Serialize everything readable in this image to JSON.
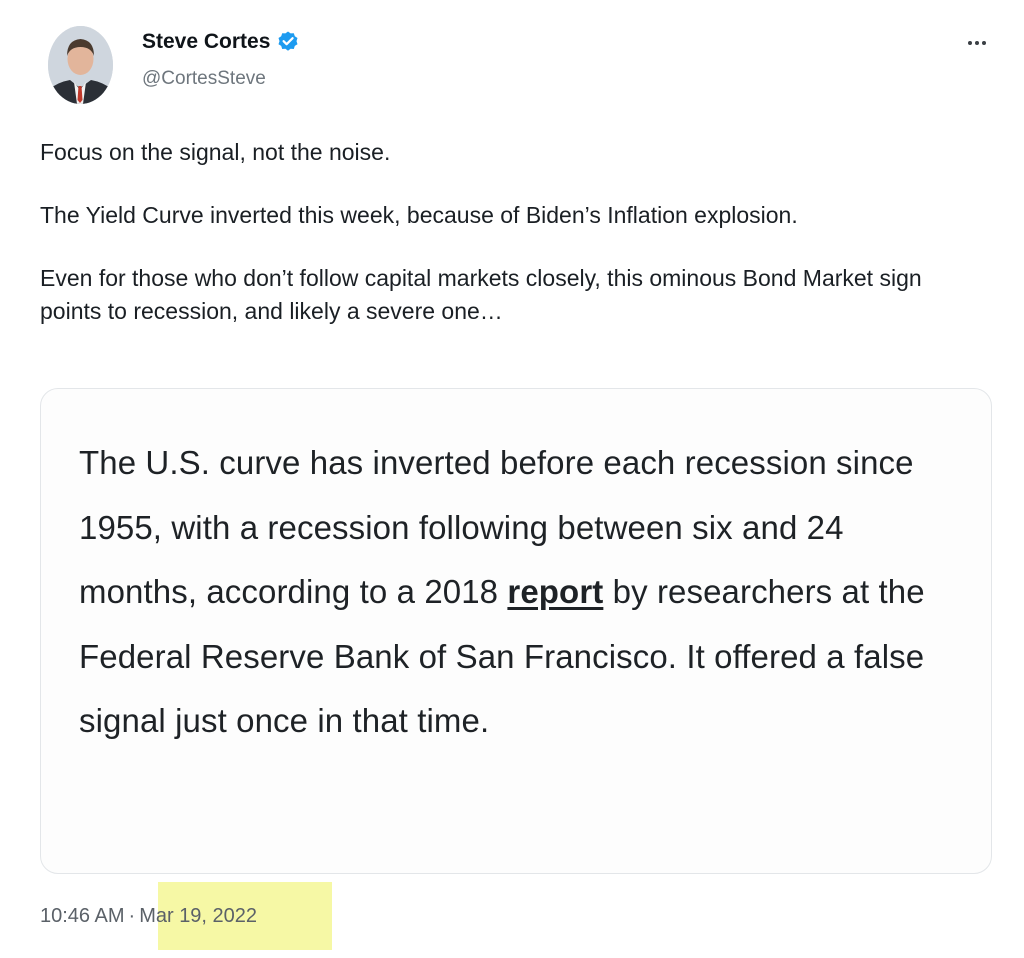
{
  "author": {
    "display_name": "Steve Cortes",
    "handle": "@CortesSteve",
    "verified": true,
    "verified_color": "#1d9bf0",
    "avatar_icon": "profile-photo"
  },
  "more_icon": "more-horizontal-icon",
  "tweet": {
    "paragraphs": [
      "Focus on the signal, not the noise.",
      "The Yield Curve inverted this week, because of Biden’s Inflation explosion.",
      "Even for those who don’t follow capital markets closely, this ominous Bond Market sign points to recession, and likely a severe one…"
    ]
  },
  "quote": {
    "text_before_link": "The U.S. curve has inverted before each recession since 1955, with a recession following between six and 24 months, according to a 2018 ",
    "link_text": "report",
    "text_after_link": " by researchers at the Federal Reserve Bank of San Francisco. It offered a false signal just once in that time."
  },
  "meta": {
    "time": "10:46 AM",
    "separator": "·",
    "date": "Mar 19, 2022",
    "date_highlight_color": "#f6f8a5"
  }
}
